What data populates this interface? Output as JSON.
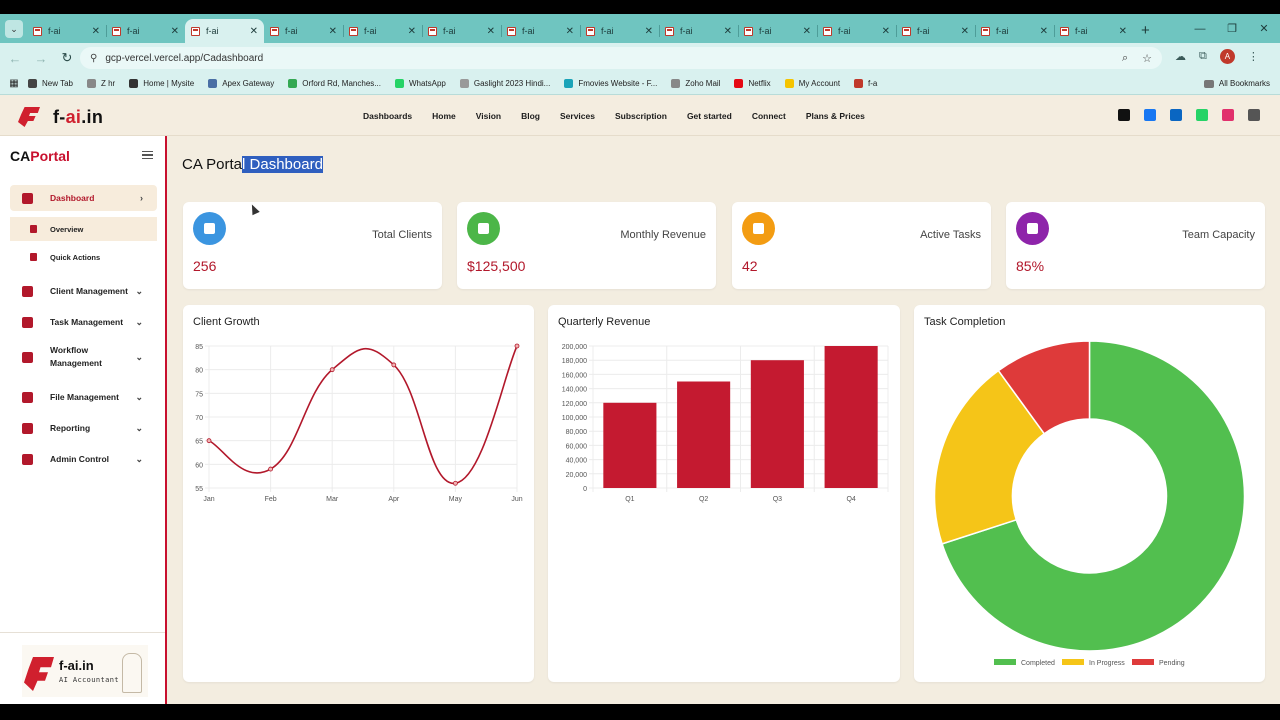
{
  "browser": {
    "tabs": [
      {
        "label": "f-ai"
      },
      {
        "label": "f-ai"
      },
      {
        "label": "f-ai",
        "active": true
      },
      {
        "label": "f-ai"
      },
      {
        "label": "f-ai"
      },
      {
        "label": "f-ai"
      },
      {
        "label": "f-ai"
      },
      {
        "label": "f-ai"
      },
      {
        "label": "f-ai"
      },
      {
        "label": "f-ai"
      },
      {
        "label": "f-ai"
      },
      {
        "label": "f-ai"
      },
      {
        "label": "f-ai"
      },
      {
        "label": "f-ai"
      }
    ],
    "new_tab": "+",
    "url": "gcp-vercel.vercel.app/Cadashboard",
    "bookmarks": [
      {
        "label": "New Tab",
        "color": "#444"
      },
      {
        "label": "Z hr",
        "color": "#888"
      },
      {
        "label": "Home | Mysite",
        "color": "#333"
      },
      {
        "label": "Apex Gateway",
        "color": "#4a6fa5"
      },
      {
        "label": "Orford Rd, Manches...",
        "color": "#34a853"
      },
      {
        "label": "WhatsApp",
        "color": "#25d366"
      },
      {
        "label": "Gaslight 2023 Hindi...",
        "color": "#999"
      },
      {
        "label": "Fmovies Website - F...",
        "color": "#1aa3b8"
      },
      {
        "label": "Zoho Mail",
        "color": "#888"
      },
      {
        "label": "Netflix",
        "color": "#e50914"
      },
      {
        "label": "My Account",
        "color": "#f5c400"
      },
      {
        "label": "f-a",
        "color": "#c0392b"
      }
    ],
    "all_bookmarks": "All Bookmarks",
    "profile_initial": "A"
  },
  "site": {
    "logo_prefix": "f-",
    "logo_highlight": "ai",
    "logo_suffix": ".in",
    "nav": [
      "Dashboards",
      "Home",
      "Vision",
      "Blog",
      "Services",
      "Subscription",
      "Get started",
      "Connect",
      "Plans & Prices"
    ],
    "social_icons": [
      {
        "name": "x-icon",
        "color": "#111"
      },
      {
        "name": "facebook-icon",
        "color": "#1877f2"
      },
      {
        "name": "linkedin-icon",
        "color": "#0a66c2"
      },
      {
        "name": "whatsapp-icon",
        "color": "#25d366"
      },
      {
        "name": "instagram-icon",
        "color": "#e1306c"
      },
      {
        "name": "lock-icon",
        "color": "#555"
      }
    ]
  },
  "sidebar": {
    "brand_a": "CA",
    "brand_b": "Portal",
    "items": [
      {
        "label": "Dashboard",
        "icon": "dashboard-icon",
        "chevron": "›",
        "active": true
      },
      {
        "label": "Client Management",
        "icon": "users-icon",
        "chevron": "⌄"
      },
      {
        "label": "Task Management",
        "icon": "clipboard-icon",
        "chevron": "⌄"
      },
      {
        "label": "Workflow Management",
        "icon": "briefcase-icon",
        "chevron": "⌄"
      },
      {
        "label": "File Management",
        "icon": "file-icon",
        "chevron": "⌄"
      },
      {
        "label": "Reporting",
        "icon": "alert-icon",
        "chevron": "⌄"
      },
      {
        "label": "Admin Control",
        "icon": "admin-icon",
        "chevron": "⌄"
      }
    ],
    "subitems": [
      {
        "label": "Overview",
        "active": true
      },
      {
        "label": "Quick Actions"
      }
    ],
    "footer_logo": "f-ai.in",
    "footer_tagline": "AI Accountant"
  },
  "page": {
    "title_a": "CA Porta",
    "title_b": "l Dashboard"
  },
  "stats": [
    {
      "label": "Total Clients",
      "value": "256",
      "color": "#3b95e0",
      "icon": "users-icon"
    },
    {
      "label": "Monthly Revenue",
      "value": "$125,500",
      "color": "#4cb648",
      "icon": "dollar-icon"
    },
    {
      "label": "Active Tasks",
      "value": "42",
      "color": "#f39c12",
      "icon": "task-icon"
    },
    {
      "label": "Team Capacity",
      "value": "85%",
      "color": "#8e24aa",
      "icon": "briefcase-icon"
    }
  ],
  "chart_data": [
    {
      "type": "line",
      "title": "Client Growth",
      "categories": [
        "Jan",
        "Feb",
        "Mar",
        "Apr",
        "May",
        "Jun"
      ],
      "values": [
        65,
        59,
        80,
        81,
        56,
        85
      ],
      "ylim": [
        55,
        85
      ],
      "yticks": [
        55,
        60,
        65,
        70,
        75,
        80,
        85
      ],
      "color": "#b2182b",
      "grid": true
    },
    {
      "type": "bar",
      "title": "Quarterly Revenue",
      "categories": [
        "Q1",
        "Q2",
        "Q3",
        "Q4"
      ],
      "values": [
        120000,
        150000,
        180000,
        200000
      ],
      "ylim": [
        0,
        200000
      ],
      "yticks": [
        "0",
        "20,000",
        "40,000",
        "60,000",
        "80,000",
        "100,000",
        "120,000",
        "140,000",
        "160,000",
        "180,000",
        "200,000"
      ],
      "color": "#c41a30",
      "grid": true
    },
    {
      "type": "pie",
      "title": "Task Completion",
      "labels": [
        "Completed",
        "In Progress",
        "Pending"
      ],
      "values": [
        70,
        20,
        10
      ],
      "colors": [
        "#52bf4f",
        "#f5c518",
        "#de3a3a"
      ],
      "legend": "bottom"
    }
  ]
}
